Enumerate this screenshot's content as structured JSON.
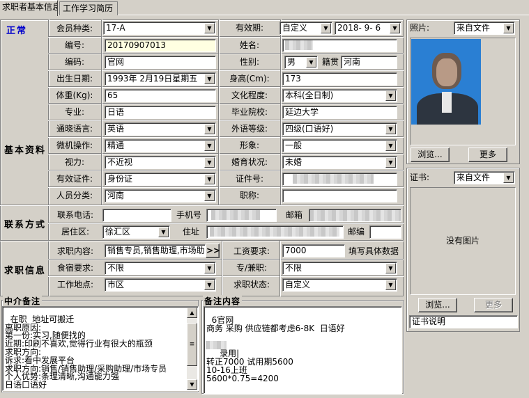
{
  "tabs": [
    {
      "label": "求职者基本信息"
    },
    {
      "label": "工作学习简历"
    }
  ],
  "status": {
    "label": "正常",
    "color": "#0000cc"
  },
  "sections": {
    "basic": "基本资料",
    "contact": "联系方式",
    "job": "求职信息"
  },
  "fields": {
    "member_type": {
      "label": "会员种类:",
      "value": "17-A"
    },
    "validity": {
      "label": "有效期:",
      "value": "自定义",
      "date": "2018- 9- 6"
    },
    "number": {
      "label": "编号:",
      "value": "20170907013"
    },
    "name": {
      "label": "姓名:"
    },
    "code": {
      "label": "编码:",
      "value": "官网"
    },
    "gender": {
      "label": "性别:",
      "value": "男"
    },
    "native": {
      "label": "籍贯",
      "value": "河南"
    },
    "birth": {
      "label": "出生日期:",
      "value": "1993年 2月19日星期五"
    },
    "height": {
      "label": "身高(Cm):",
      "value": "173"
    },
    "weight": {
      "label": "体重(Kg):",
      "value": "65"
    },
    "education": {
      "label": "文化程度:",
      "value": "本科(全日制)"
    },
    "major": {
      "label": "专业:",
      "value": "日语"
    },
    "school": {
      "label": "毕业院校:",
      "value": "延边大学"
    },
    "language": {
      "label": "通晓语言:",
      "value": "英语"
    },
    "foreign_level": {
      "label": "外语等级:",
      "value": "四级(口语好)"
    },
    "computer": {
      "label": "微机操作:",
      "value": "精通"
    },
    "image": {
      "label": "形象:",
      "value": "一般"
    },
    "vision": {
      "label": "视力:",
      "value": "不近视"
    },
    "marital": {
      "label": "婚育状况:",
      "value": "未婚"
    },
    "id_type": {
      "label": "有效证件:",
      "value": "身份证"
    },
    "id_no": {
      "label": "证件号:"
    },
    "category": {
      "label": "人员分类:",
      "value": "河南"
    },
    "title": {
      "label": "职称:"
    },
    "phone": {
      "label": "联系电话:"
    },
    "mobile": {
      "label": "手机号"
    },
    "email": {
      "label": "邮箱"
    },
    "district": {
      "label": "居住区:",
      "value": "徐汇区"
    },
    "address": {
      "label": "住址"
    },
    "postcode": {
      "label": "邮编"
    },
    "job_content": {
      "label": "求职内容:",
      "value": "销售专员,销售助理,市场助",
      "btn": ">>"
    },
    "salary": {
      "label": "工资要求:",
      "value": "7000",
      "hint": "填写具体数据"
    },
    "board": {
      "label": "食宿要求:",
      "value": "不限"
    },
    "parttime": {
      "label": "专/兼职:",
      "value": "不限"
    },
    "location": {
      "label": "工作地点:",
      "value": "市区"
    },
    "job_status": {
      "label": "求职状态:",
      "value": "自定义"
    }
  },
  "photo": {
    "label": "照片:",
    "source": "来自文件",
    "browse": "浏览...",
    "more": "更多"
  },
  "cert": {
    "label": "证书:",
    "source": "来自文件",
    "empty": "没有图片",
    "browse": "浏览...",
    "more": "更多",
    "desc": "证书说明"
  },
  "agent_notes": {
    "title": "中介备注",
    "text": "在职  地址可搬迁\n离职原因:\n第一份:实习,随便找的\n近期:印刷不喜欢,觉得行业有很大的瓶颈\n求职方向:\n诉求:看中发展平台\n求职方向:销售/销售助理/采购助理/市场专员\n个人优势:条理清晰,沟通能力强\n日语口语好"
  },
  "remarks": {
    "title": "备注内容",
    "text": "6官网\n商务 采购 供应链都考虑6-8K  日语好\n\n\n     录用|\n转正7000 试用期5600\n10-16上班\n5600*0.75=4200"
  }
}
